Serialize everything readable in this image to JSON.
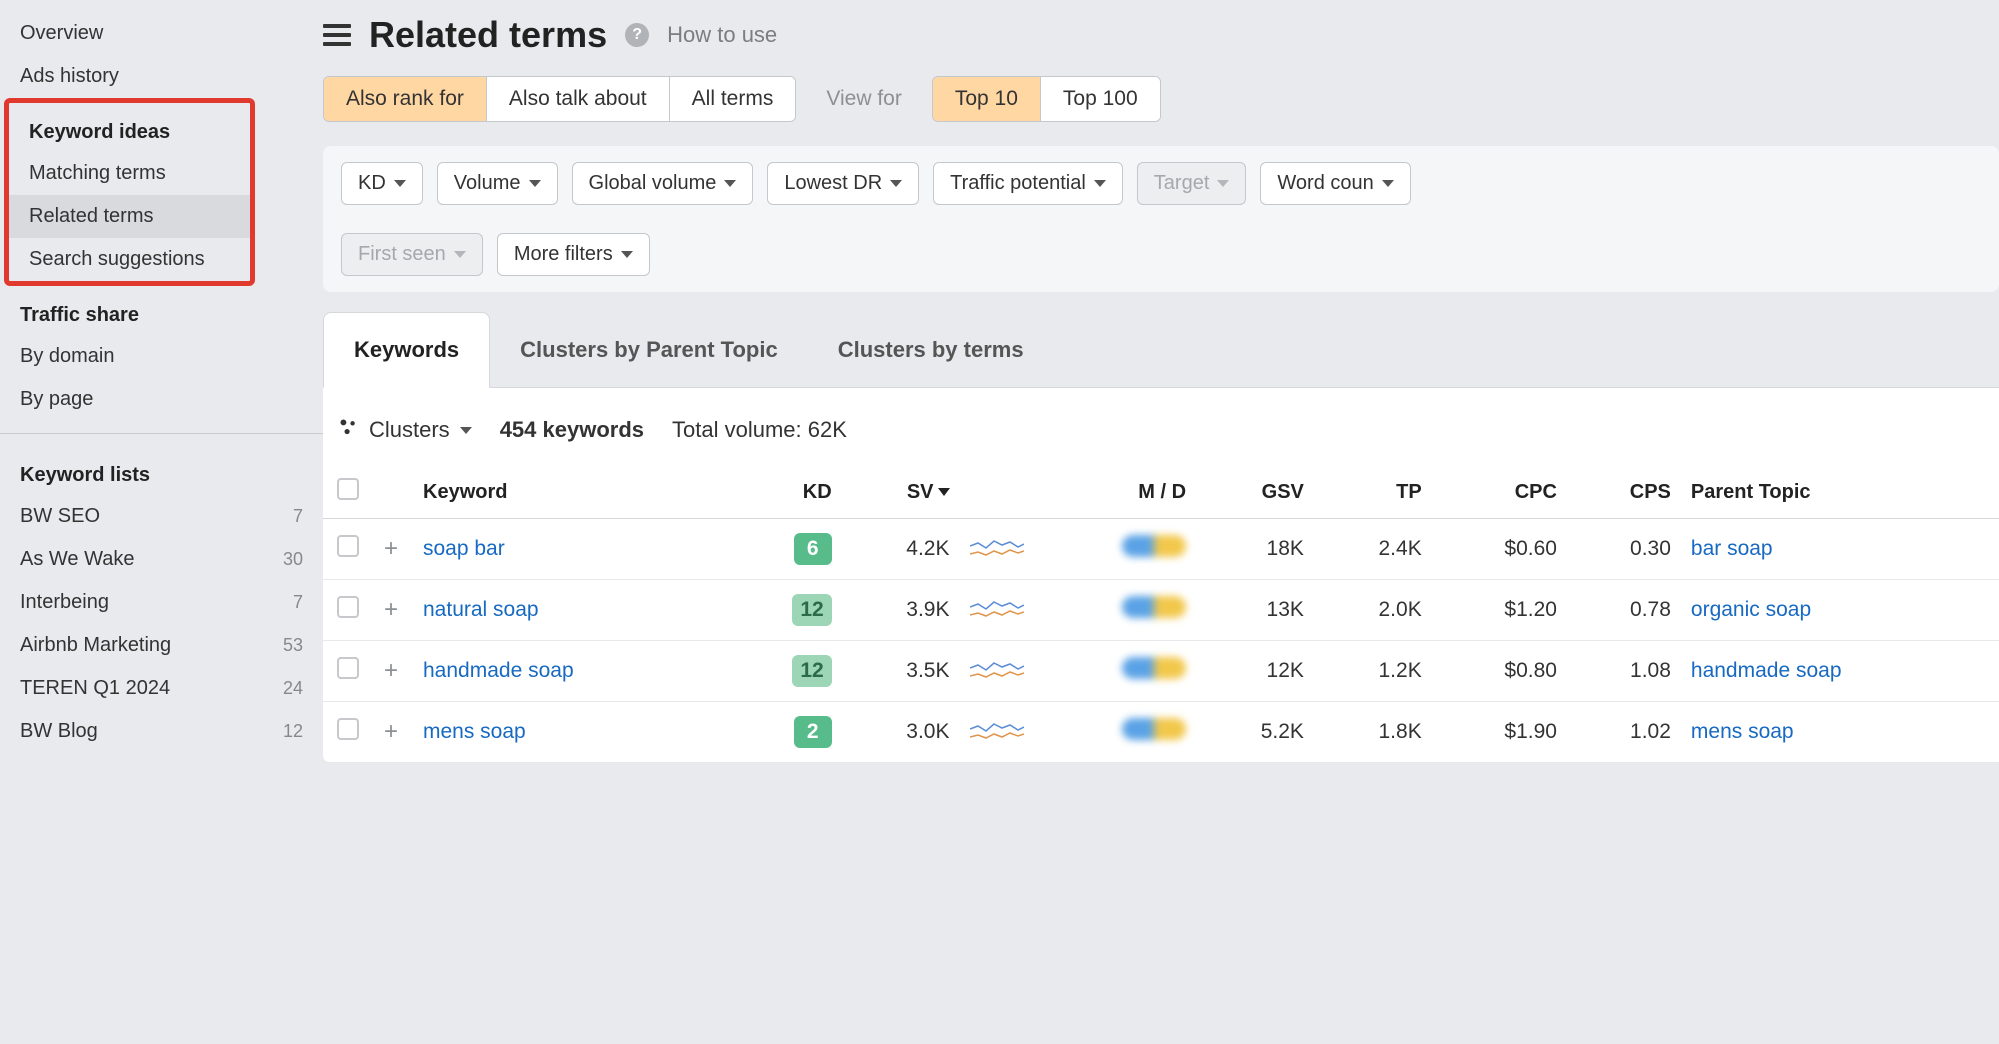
{
  "sidebar": {
    "top_items": [
      "Overview",
      "Ads history"
    ],
    "keyword_ideas": {
      "heading": "Keyword ideas",
      "items": [
        "Matching terms",
        "Related terms",
        "Search suggestions"
      ],
      "active_index": 1
    },
    "traffic_share": {
      "heading": "Traffic share",
      "items": [
        "By domain",
        "By page"
      ]
    },
    "keyword_lists": {
      "heading": "Keyword lists",
      "items": [
        {
          "name": "BW SEO",
          "count": 7
        },
        {
          "name": "As We Wake",
          "count": 30
        },
        {
          "name": "Interbeing",
          "count": 7
        },
        {
          "name": "Airbnb Marketing",
          "count": 53
        },
        {
          "name": "TEREN Q1 2024",
          "count": 24
        },
        {
          "name": "BW Blog",
          "count": 12
        }
      ]
    }
  },
  "header": {
    "title": "Related terms",
    "help": "How to use"
  },
  "view_tabs": {
    "primary": [
      "Also rank for",
      "Also talk about",
      "All terms"
    ],
    "primary_active": 0,
    "viewfor_label": "View for",
    "secondary": [
      "Top 10",
      "Top 100"
    ],
    "secondary_active": 0
  },
  "filters": {
    "items": [
      "KD",
      "Volume",
      "Global volume",
      "Lowest DR",
      "Traffic potential",
      "Target",
      "Word coun"
    ],
    "disabled": [
      5
    ],
    "row2": [
      "First seen",
      "More filters"
    ],
    "row2_disabled": [
      0
    ]
  },
  "section_tabs": {
    "items": [
      "Keywords",
      "Clusters by Parent Topic",
      "Clusters by terms"
    ],
    "active": 0
  },
  "summary": {
    "clusters_label": "Clusters",
    "keyword_count": "454 keywords",
    "total_volume_label": "Total volume: ",
    "total_volume_value": "62K"
  },
  "table": {
    "columns": [
      "Keyword",
      "KD",
      "SV",
      "M / D",
      "GSV",
      "TP",
      "CPC",
      "CPS",
      "Parent Topic"
    ],
    "sort_col": "SV",
    "rows": [
      {
        "keyword": "soap bar",
        "kd": 6,
        "kd_class": "kd-green",
        "sv": "4.2K",
        "gsv": "18K",
        "tp": "2.4K",
        "cpc": "$0.60",
        "cps": "0.30",
        "parent": "bar soap"
      },
      {
        "keyword": "natural soap",
        "kd": 12,
        "kd_class": "kd-lgreen",
        "sv": "3.9K",
        "gsv": "13K",
        "tp": "2.0K",
        "cpc": "$1.20",
        "cps": "0.78",
        "parent": "organic soap"
      },
      {
        "keyword": "handmade soap",
        "kd": 12,
        "kd_class": "kd-lgreen",
        "sv": "3.5K",
        "gsv": "12K",
        "tp": "1.2K",
        "cpc": "$0.80",
        "cps": "1.08",
        "parent": "handmade soap"
      },
      {
        "keyword": "mens soap",
        "kd": 2,
        "kd_class": "kd-green",
        "sv": "3.0K",
        "gsv": "5.2K",
        "tp": "1.8K",
        "cpc": "$1.90",
        "cps": "1.02",
        "parent": "mens soap"
      }
    ]
  }
}
